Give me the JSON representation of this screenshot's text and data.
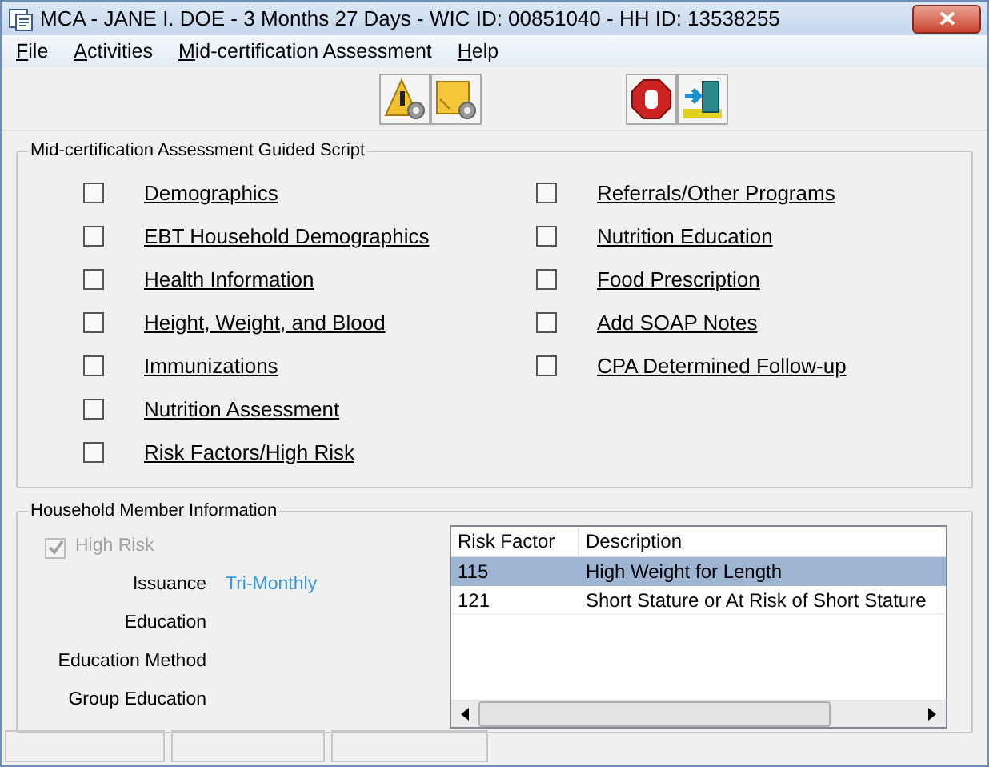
{
  "window": {
    "title": "MCA - JANE I. DOE - 3 Months 27 Days - WIC ID: 00851040 - HH ID: 13538255"
  },
  "menu": [
    {
      "label": "File"
    },
    {
      "label": "Activities"
    },
    {
      "label": "Mid-certification Assessment"
    },
    {
      "label": "Help"
    }
  ],
  "guided_script": {
    "title": "Mid-certification Assessment Guided Script",
    "columns": [
      [
        {
          "label": "Demographics",
          "checked": false
        },
        {
          "label": "EBT Household Demographics",
          "checked": false
        },
        {
          "label": "Health Information",
          "checked": false
        },
        {
          "label": "Height, Weight, and Blood",
          "checked": false
        },
        {
          "label": "Immunizations",
          "checked": false
        },
        {
          "label": "Nutrition Assessment",
          "checked": false
        },
        {
          "label": "Risk Factors/High Risk",
          "checked": false
        }
      ],
      [
        {
          "label": "Referrals/Other Programs",
          "checked": false
        },
        {
          "label": "Nutrition Education",
          "checked": false
        },
        {
          "label": "Food Prescription",
          "checked": false
        },
        {
          "label": "Add SOAP Notes",
          "checked": false
        },
        {
          "label": "CPA Determined Follow-up",
          "checked": false
        }
      ]
    ]
  },
  "household": {
    "title": "Household Member Information",
    "high_risk": {
      "label": "High Risk",
      "checked": true,
      "disabled": true
    },
    "fields": [
      {
        "label": "Issuance",
        "value": "Tri-Monthly"
      },
      {
        "label": "Education"
      },
      {
        "label": "Education Method"
      },
      {
        "label": "Group Education"
      }
    ],
    "risk_table": {
      "columns": [
        "Risk Factor",
        "Description"
      ],
      "rows": [
        {
          "cells": [
            "115",
            "High Weight for Length"
          ],
          "selected": true
        },
        {
          "cells": [
            "121",
            "Short Stature or At Risk of Short Stature"
          ],
          "selected": false
        }
      ]
    }
  }
}
